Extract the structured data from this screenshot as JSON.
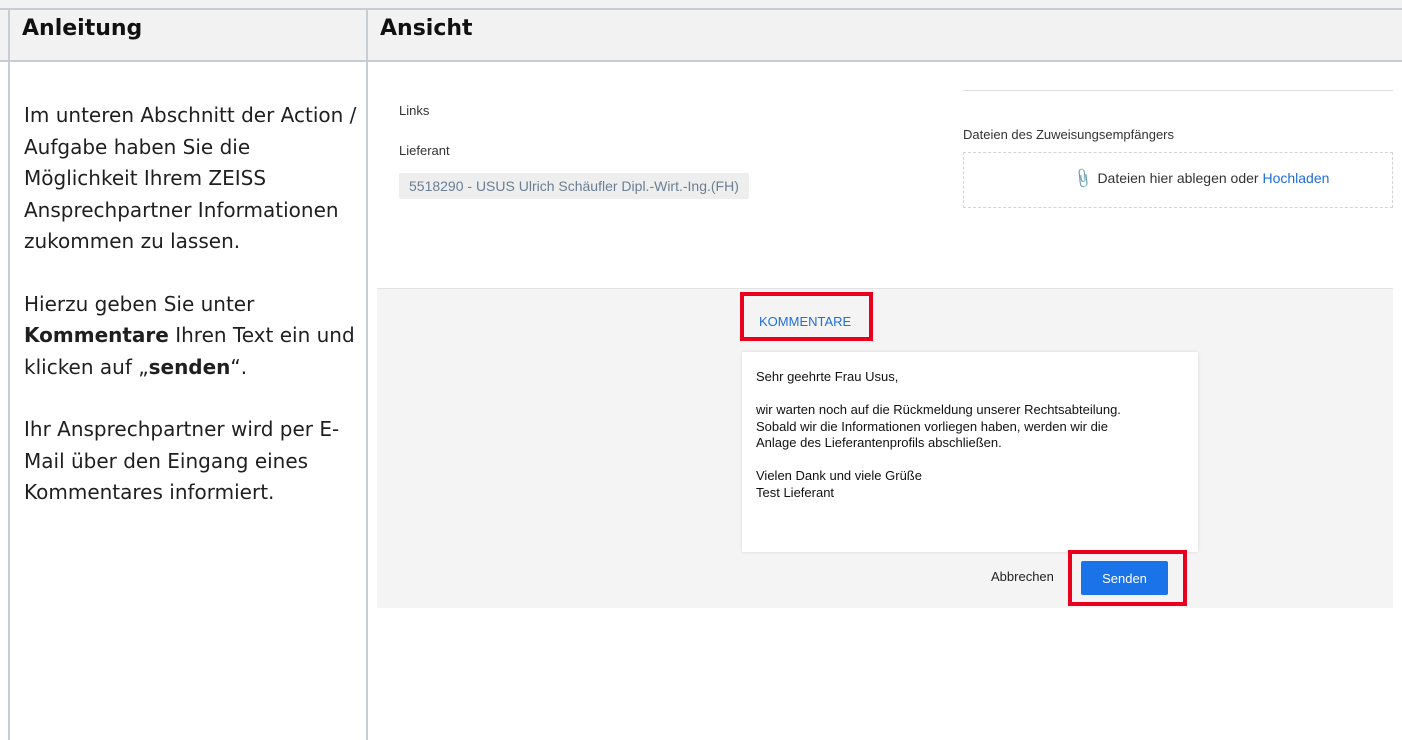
{
  "table": {
    "header_left": "Anleitung",
    "header_right": "Ansicht"
  },
  "instructions": {
    "p1": "Im unteren Abschnitt der Action / Aufgabe haben Sie die Möglichkeit Ihrem ZEISS Ansprechpartner Informationen zukommen zu lassen.",
    "p2_before": "Hierzu geben Sie unter ",
    "p2_bold": "Kommentare",
    "p2_middle": " Ihren Text ein und klicken auf „",
    "p2_bold2": "senden",
    "p2_after": "“.",
    "p3": "Ihr Ansprechpartner wird per E-Mail über den Eingang eines Kommentares informiert."
  },
  "screenshot": {
    "links_label": "Links",
    "supplier_label": "Lieferant",
    "supplier_value": "5518290 - USUS Ulrich Schäufler Dipl.-Wirt.-Ing.(FH)",
    "assignee_files_label": "Dateien des Zuweisungsempfängers",
    "dropzone_text": "Dateien hier ablegen oder",
    "dropzone_link": "Hochladen",
    "comments_tab": "KOMMENTARE",
    "comment_lines": {
      "l1": "Sehr geehrte Frau Usus,",
      "l2": "wir warten noch auf die Rückmeldung unserer Rechtsabteilung.",
      "l3": "Sobald wir die Informationen vorliegen haben, werden wir die",
      "l4": "Anlage des Lieferantenprofils abschließen.",
      "l5": "Vielen Dank und viele Grüße",
      "l6": "Test Lieferant"
    },
    "cancel_label": "Abbrechen",
    "send_label": "Senden",
    "highlight_color": "#e8001c",
    "accent_color": "#1a73e8",
    "paperclip_icon": "📎"
  }
}
